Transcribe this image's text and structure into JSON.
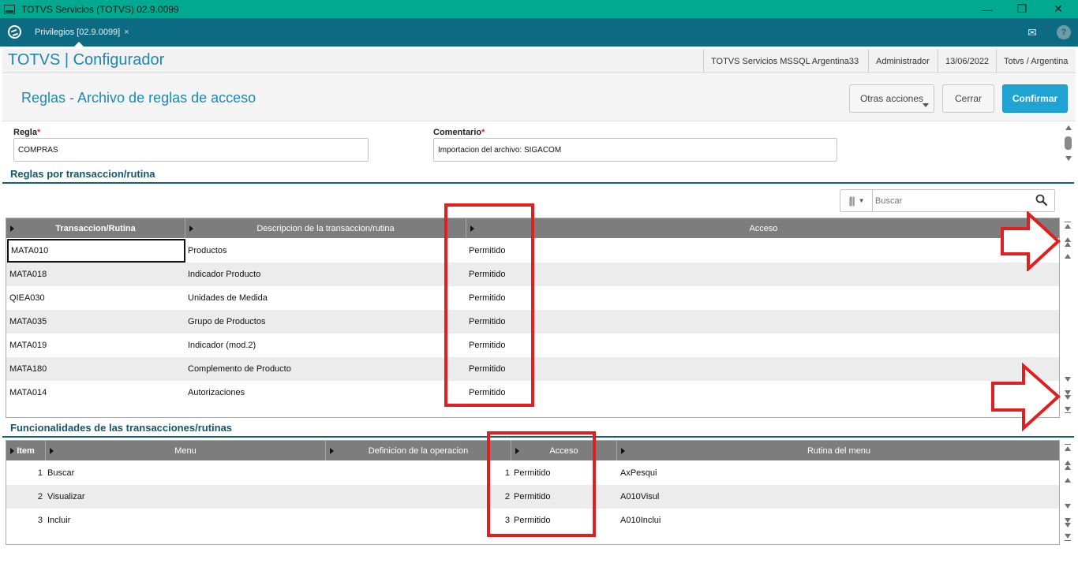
{
  "window": {
    "title": "TOTVS Servicios (TOTVS) 02.9.0099",
    "minimize": "—",
    "restore": "❐",
    "close": "✕"
  },
  "tabs": [
    {
      "label": "Privilegios [02.9.0099]",
      "close": "×"
    }
  ],
  "tabbar_icons": {
    "mail": "✉",
    "help": "?"
  },
  "header": {
    "app_title": "TOTVS | Configurador",
    "environment": "TOTVS Servicios MSSQL Argentina33",
    "user": "Administrador",
    "date": "13/06/2022",
    "company": "Totvs / Argentina"
  },
  "page": {
    "title": "Reglas - Archivo de reglas de acceso",
    "other_actions": "Otras acciones",
    "close": "Cerrar",
    "confirm": "Confirmar"
  },
  "form": {
    "rule_label": "Regla",
    "rule_value": "COMPRAS",
    "comment_label": "Comentario",
    "comment_value": "Importacion del archivo: SIGACOM",
    "required_mark": "*"
  },
  "rules_section": {
    "title": "Reglas por transaccion/rutina",
    "search_placeholder": "Buscar",
    "columns": [
      "Transaccion/Rutina",
      "Descripcion de la transaccion/rutina",
      "Acceso"
    ],
    "rows": [
      [
        "MATA010",
        "Productos",
        "Permitido"
      ],
      [
        "MATA018",
        "Indicador Producto",
        "Permitido"
      ],
      [
        "QIEA030",
        "Unidades de Medida",
        "Permitido"
      ],
      [
        "MATA035",
        "Grupo de Productos",
        "Permitido"
      ],
      [
        "MATA019",
        "Indicador (mod.2)",
        "Permitido"
      ],
      [
        "MATA180",
        "Complemento de Producto",
        "Permitido"
      ],
      [
        "MATA014",
        "Autorizaciones",
        "Permitido"
      ]
    ]
  },
  "functions_section": {
    "title": "Funcionalidades de las transacciones/rutinas",
    "columns": [
      "Item",
      "Menu",
      "Definicion de la operacion",
      "Acceso",
      "Rutina del menu"
    ],
    "rows": [
      [
        "1",
        "Buscar",
        "",
        "1",
        "Permitido",
        "AxPesqui"
      ],
      [
        "2",
        "Visualizar",
        "",
        "2",
        "Permitido",
        "A010Visul"
      ],
      [
        "3",
        "Incluir",
        "",
        "3",
        "Permitido",
        "A010Inclui"
      ]
    ]
  },
  "colors": {
    "titlebar": "#00a98f",
    "tabbar": "#0c6a82",
    "accent": "#1a89b4",
    "primary_button": "#1ea3d2",
    "grid_header": "#7d7d7d",
    "annotation_red": "#e02020"
  }
}
